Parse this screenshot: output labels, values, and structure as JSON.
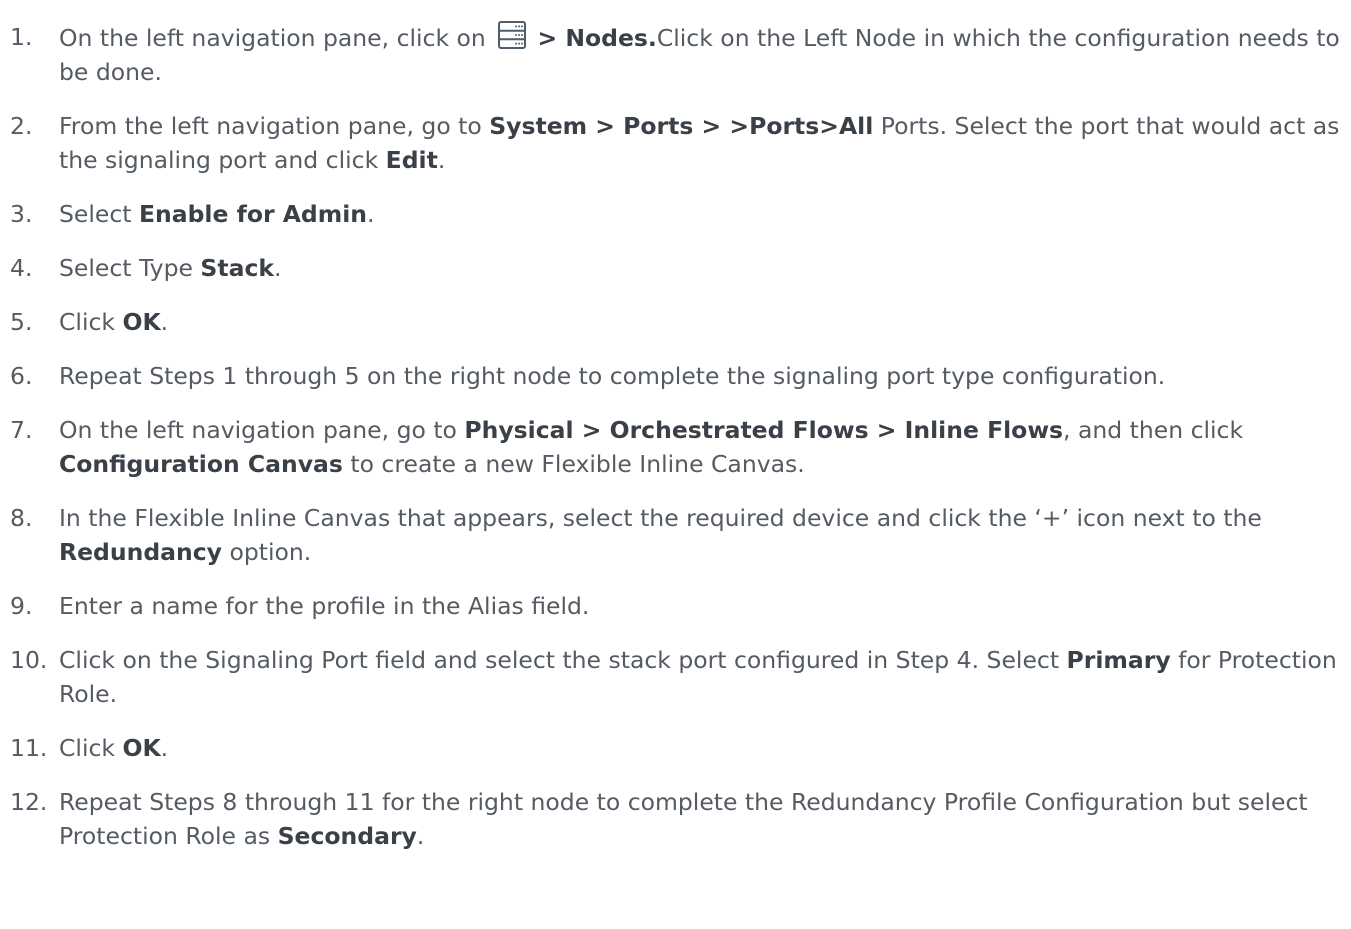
{
  "steps": [
    {
      "num": "1.",
      "parts": [
        {
          "t": "On the left navigation pane, click on "
        },
        {
          "icon": "server-icon"
        },
        {
          "t": " > Nodes.",
          "b": true
        },
        {
          "t": "Click on the Left Node in which the configuration needs to be done."
        }
      ]
    },
    {
      "num": "2.",
      "parts": [
        {
          "t": "From the left navigation pane, go to "
        },
        {
          "t": "System > Ports > >Ports>All",
          "b": true
        },
        {
          "t": " Ports. Select the port that would act as the signaling port and click "
        },
        {
          "t": "Edit",
          "b": true
        },
        {
          "t": "."
        }
      ]
    },
    {
      "num": "3.",
      "parts": [
        {
          "t": "Select "
        },
        {
          "t": "Enable for Admin",
          "b": true
        },
        {
          "t": "."
        }
      ]
    },
    {
      "num": "4.",
      "parts": [
        {
          "t": "Select Type "
        },
        {
          "t": "Stack",
          "b": true
        },
        {
          "t": "."
        }
      ]
    },
    {
      "num": "5.",
      "parts": [
        {
          "t": "Click "
        },
        {
          "t": "OK",
          "b": true
        },
        {
          "t": "."
        }
      ]
    },
    {
      "num": "6.",
      "parts": [
        {
          "t": "Repeat Steps 1 through 5 on the right node to complete the signaling port type configuration."
        }
      ]
    },
    {
      "num": "7.",
      "parts": [
        {
          "t": "On the left navigation pane, go to "
        },
        {
          "t": "Physical > Orchestrated Flows > Inline Flows",
          "b": true
        },
        {
          "t": ", and then click "
        },
        {
          "t": "Configuration Canvas",
          "b": true
        },
        {
          "t": " to create a new Flexible Inline Canvas."
        }
      ]
    },
    {
      "num": "8.",
      "parts": [
        {
          "t": "In the Flexible Inline Canvas that appears, select the required device and click the ‘+’ icon next to the "
        },
        {
          "t": "Redundancy",
          "b": true
        },
        {
          "t": " option."
        }
      ]
    },
    {
      "num": "9.",
      "parts": [
        {
          "t": "Enter a name for the profile in the Alias field."
        }
      ]
    },
    {
      "num": "10.",
      "parts": [
        {
          "t": "Click on the Signaling Port field and select the stack port configured in Step 4. Select "
        },
        {
          "t": "Primary",
          "b": true
        },
        {
          "t": " for Protection Role."
        }
      ]
    },
    {
      "num": "11.",
      "parts": [
        {
          "t": "Click "
        },
        {
          "t": "OK",
          "b": true
        },
        {
          "t": "."
        }
      ]
    },
    {
      "num": "12.",
      "parts": [
        {
          "t": "Repeat Steps 8 through 11 for the right node to complete the Redundancy Profile Configuration but select Protection Role as "
        },
        {
          "t": "Secondary",
          "b": true
        },
        {
          "t": "."
        }
      ]
    }
  ]
}
